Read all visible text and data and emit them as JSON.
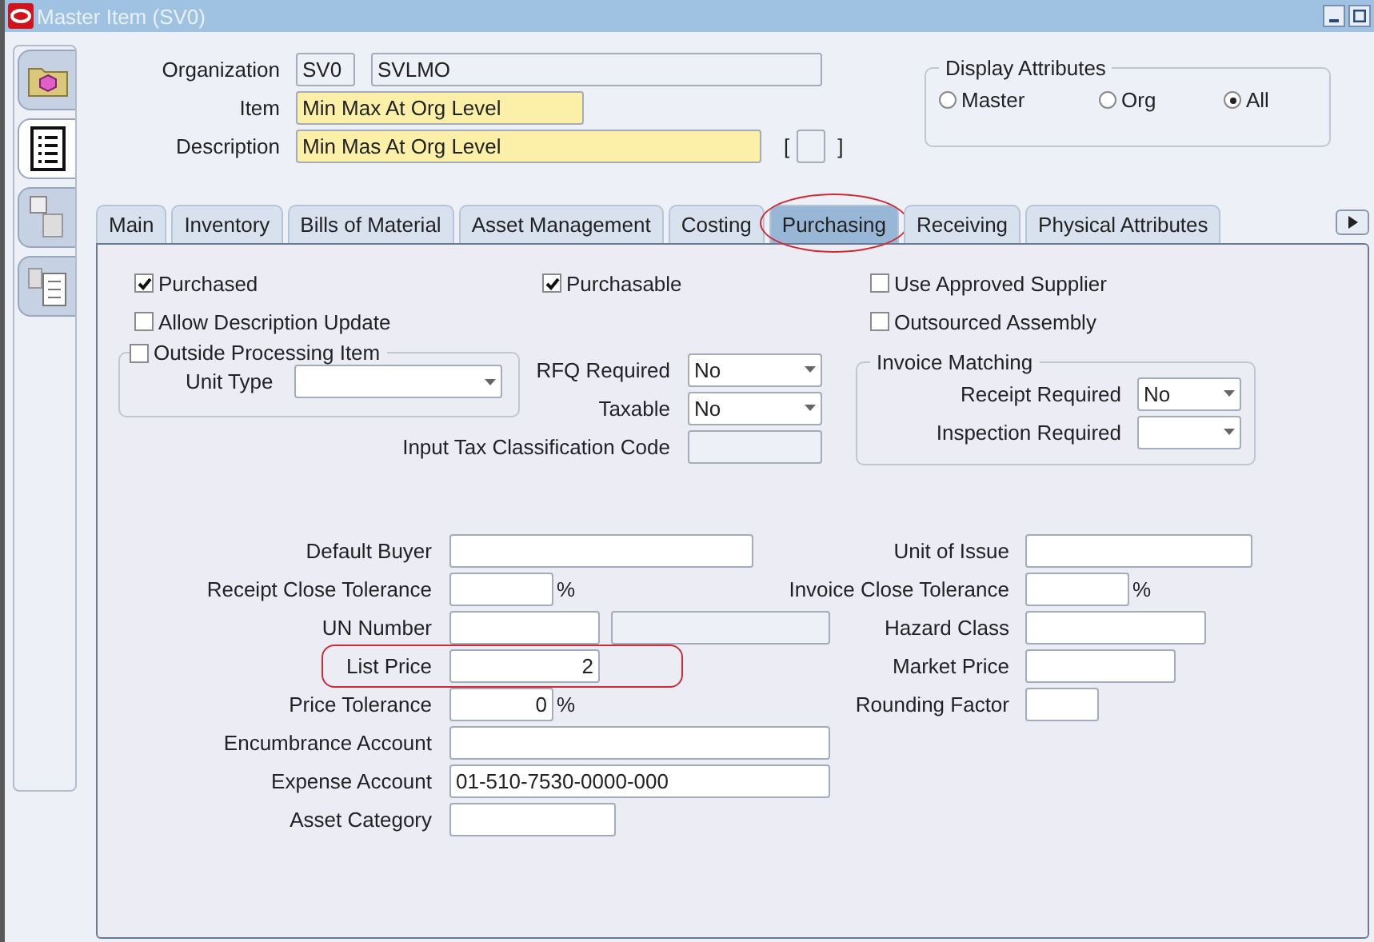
{
  "window": {
    "title": "Master Item (SV0)"
  },
  "tool_buttons": [
    {
      "kind": "folder",
      "selected": false
    },
    {
      "kind": "list",
      "selected": true
    },
    {
      "kind": "image",
      "selected": false
    },
    {
      "kind": "numbered",
      "selected": false
    }
  ],
  "header": {
    "organization": {
      "label": "Organization",
      "code": "SV0",
      "name": "SVLMO"
    },
    "item": {
      "label": "Item",
      "value": "Min Max At Org Level"
    },
    "description": {
      "label": "Description",
      "value": "Min Mas At Org Level",
      "open": "[",
      "close": "]"
    }
  },
  "display_attributes": {
    "title": "Display Attributes",
    "options": [
      {
        "label": "Master",
        "selected": false
      },
      {
        "label": "Org",
        "selected": false
      },
      {
        "label": "All",
        "selected": true
      }
    ]
  },
  "tabs": [
    {
      "label": "Main",
      "selected": false,
      "highlighted": false
    },
    {
      "label": "Inventory",
      "selected": false,
      "highlighted": false
    },
    {
      "label": "Bills of Material",
      "selected": false,
      "highlighted": false
    },
    {
      "label": "Asset Management",
      "selected": false,
      "highlighted": false
    },
    {
      "label": "Costing",
      "selected": false,
      "highlighted": false
    },
    {
      "label": "Purchasing",
      "selected": true,
      "highlighted": true
    },
    {
      "label": "Receiving",
      "selected": false,
      "highlighted": false
    },
    {
      "label": "Physical Attributes",
      "selected": false,
      "highlighted": false
    }
  ],
  "check_rows": [
    [
      {
        "label": "Purchased",
        "checked": true
      },
      {
        "label": "Purchasable",
        "checked": true
      },
      {
        "label": "Use Approved Supplier",
        "checked": false
      }
    ],
    [
      {
        "label": "Allow Description Update",
        "checked": false
      },
      null,
      {
        "label": "Outsourced Assembly",
        "checked": false
      }
    ]
  ],
  "outside_processing": {
    "label": "Outside Processing Item",
    "checked": false,
    "unit_type_label": "Unit Type"
  },
  "rfq_required": {
    "label": "RFQ Required",
    "value": "No"
  },
  "taxable": {
    "label": "Taxable",
    "value": "No"
  },
  "input_tax_code": {
    "label": "Input Tax Classification Code"
  },
  "invoice_matching": {
    "title": "Invoice Matching",
    "rows": [
      {
        "label": "Receipt Required",
        "value": "No"
      },
      {
        "label": "Inspection Required"
      }
    ]
  },
  "fields_left": [
    {
      "label": "Default Buyer",
      "kind": "text",
      "highlighted": false
    },
    {
      "label": "Receipt Close Tolerance",
      "kind": "percent",
      "suffix": "%",
      "highlighted": false
    },
    {
      "label": "UN Number",
      "kind": "pair",
      "highlighted": false
    },
    {
      "label": "List Price",
      "kind": "numeric",
      "value": "2",
      "highlighted": true
    },
    {
      "label": "Price Tolerance",
      "kind": "percent",
      "value": "0",
      "suffix": "%",
      "highlighted": false
    },
    {
      "label": "Encumbrance Account",
      "kind": "text",
      "highlighted": false
    },
    {
      "label": "Expense Account",
      "kind": "text",
      "value": "01-510-7530-0000-000",
      "highlighted": false
    },
    {
      "label": "Asset Category",
      "kind": "text",
      "highlighted": false
    }
  ],
  "fields_right": [
    {
      "label": "Unit of Issue",
      "kind": "text"
    },
    {
      "label": "Invoice Close Tolerance",
      "kind": "percent",
      "suffix": "%"
    },
    {
      "label": "Hazard Class",
      "kind": "text"
    },
    {
      "label": "Market Price",
      "kind": "text"
    },
    {
      "label": "Rounding Factor",
      "kind": "text"
    }
  ]
}
